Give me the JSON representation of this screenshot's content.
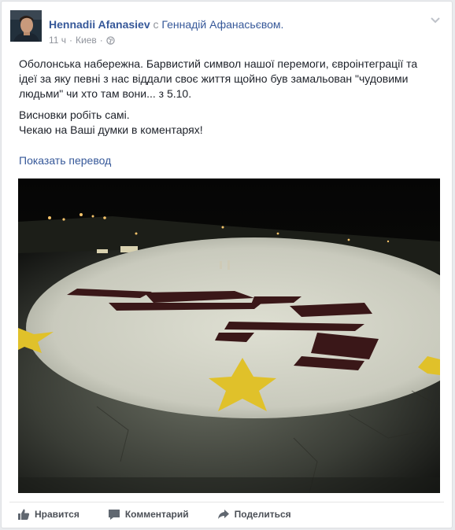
{
  "post": {
    "author": "Hennadii Afanasiev",
    "with_word": "с",
    "tagged": "Геннадій Афанасьєвом.",
    "time": "11 ч",
    "dot": "·",
    "location": "Киев",
    "paragraph1": "Оболонська набережна. Барвистий символ нашої перемоги, євроінтеграції та ідеї за яку певні з нас віддали своє життя щойно був замальован \"чудовими людьми\" чи хто там вони... з 5.10.",
    "paragraph2_line1": "Висновки робіть самі.",
    "paragraph2_line2": "Чекаю на Ваші думки в коментарях!",
    "translate_link": "Показать перевод"
  },
  "actions": {
    "like": "Нравится",
    "comment": "Комментарий",
    "share": "Поделиться"
  },
  "icons": {
    "privacy": "globe-icon",
    "menu": "chevron-down-icon",
    "like": "thumbs-up-icon",
    "comment": "comment-bubble-icon",
    "share": "share-arrow-icon"
  },
  "colors": {
    "link": "#365899",
    "meta": "#90949c",
    "text": "#1d2129",
    "action": "#4b4f56"
  }
}
